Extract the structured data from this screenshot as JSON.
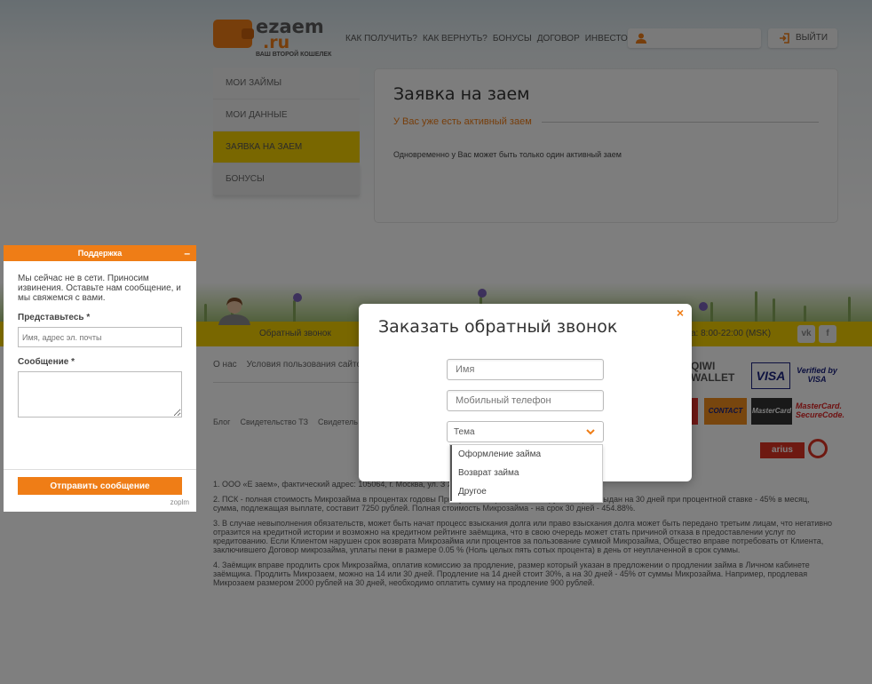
{
  "brand": {
    "logo_word": "ezaem",
    "logo_domain": ".ru",
    "tagline": "ВАШ ВТОРОЙ КОШЕЛЕК"
  },
  "header": {
    "nav": [
      "КАК ПОЛУЧИТЬ?",
      "КАК ВЕРНУТЬ?",
      "БОНУСЫ",
      "ДОГОВОР",
      "ИНВЕСТОРАМ"
    ],
    "logout_label": "ВЫЙТИ"
  },
  "sidebar": {
    "items": [
      {
        "label": "МОИ ЗАЙМЫ"
      },
      {
        "label": "МОИ ДАННЫЕ"
      },
      {
        "label": "ЗАЯВКА НА ЗАЕМ"
      },
      {
        "label": "БОНУСЫ"
      }
    ]
  },
  "main": {
    "title": "Заявка на заем",
    "subtitle": "У Вас уже есть активный заем",
    "text": "Одновременно у Вас может быть только один активный заем"
  },
  "footer": {
    "callback_link": "Обратный звонок",
    "hours": "а: 8:00-22:00 (MSK)",
    "social": [
      "vk",
      "f"
    ],
    "links_row1": [
      "О нас",
      "Условия пользования сайтом"
    ],
    "links_row2": [
      "Блог",
      "Свидетельство ТЗ",
      "Свидетель"
    ],
    "payments": {
      "qiwi": "QIWI",
      "qiwi_sub": "WALLET",
      "visa": "VISA",
      "verified": "Verified by",
      "verified_sub": "VISA",
      "contact": "CONTACT",
      "mastercard": "MasterCard",
      "mc_secure": "MasterCard.",
      "mc_secure_sub": "SecureCode.",
      "arius": "arius"
    },
    "notes": [
      "1. ООО «Е заем», фактический адрес: 105064, г. Москва, ул. З                                                                          XVI, антресоль 1, комната 1.",
      "2. ПСК - полная стоимость Микрозайма в процентах годовы                                                                          При сумме Микрозайма 5000 руб. который выдан на 30 дней при процентной ставке - 45% в месяц, сумма, подлежащая выплате, составит 7250 рублей. Полная стоимость Микрозайма - на срок 30 дней - 454.88%.",
      "3. В случае невыполнения обязательств, может быть начат процесс взыскания долга или право взыскания долга может быть передано третьим лицам, что негативно отразится на кредитной истории и возможно на кредитном рейтинге заёмщика, что в свою очередь может стать причиной отказа в предоставлении услуг по кредитованию. Если Клиентом нарушен срок возврата Микрозайма или процентов за пользование суммой Микрозайма, Общество вправе потребовать от Клиента, заключившего Договор микрозайма, уплаты пени в размере 0.05 % (Ноль целых пять сотых процента) в день от неуплаченной в срок суммы.",
      "4. Заёмщик вправе продлить срок Микрозайма, оплатив комиссию за продление, размер который указан в предложении о продлении займа в Личном кабинете заёмщика. Продлить Микрозаем, можно на 14 или 30 дней. Продление на 14 дней стоит 30%, а на 30 дней - 45% от суммы Микрозайма. Например, продлевая Микрозаем размером 2000 рублей на 30 дней, необходимо оплатить сумму на продление 900 рублей."
    ]
  },
  "chat": {
    "title": "Поддержка",
    "minimize": "–",
    "offline_message": "Мы сейчас не в сети. Приносим извинения. Оставьте нам сообщение, и мы свяжемся с вами.",
    "name_label": "Представьтесь *",
    "name_placeholder": "Имя, адрес эл. почты",
    "message_label": "Сообщение *",
    "send_label": "Отправить сообщение",
    "brand": "zoplm"
  },
  "modal": {
    "title": "Заказать обратный звонок",
    "close": "×",
    "name_placeholder": "Имя",
    "phone_placeholder": "Мобильный телефон",
    "topic_value": "Тема",
    "topic_options": [
      "Оформление займа",
      "Возврат займа",
      "Другое"
    ]
  },
  "colors": {
    "accent": "#ef7d16",
    "yellow": "#f2cf00"
  }
}
